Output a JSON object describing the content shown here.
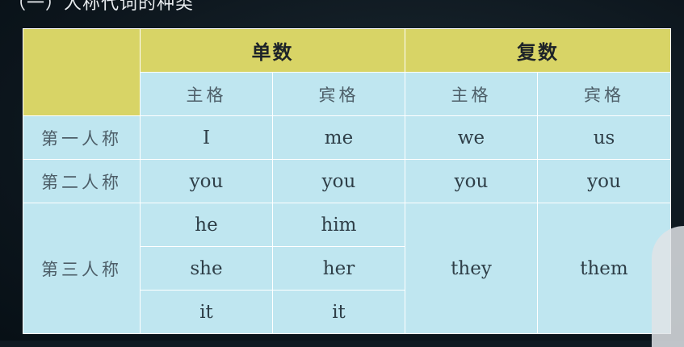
{
  "slide": {
    "heading": "（一）人称代词的种类"
  },
  "table": {
    "groups": [
      "单数",
      "复数"
    ],
    "subheaders": [
      "主格",
      "宾格",
      "主格",
      "宾格"
    ],
    "row1": {
      "label": "第一人称",
      "cells": [
        "I",
        "me",
        "we",
        "us"
      ]
    },
    "row2": {
      "label": "第二人称",
      "cells": [
        "you",
        "you",
        "you",
        "you"
      ]
    },
    "row3": {
      "label": "第三人称",
      "singular_subject": [
        "he",
        "she",
        "it"
      ],
      "singular_object": [
        "him",
        "her",
        "it"
      ],
      "plural_subject": "they",
      "plural_object": "them"
    }
  }
}
